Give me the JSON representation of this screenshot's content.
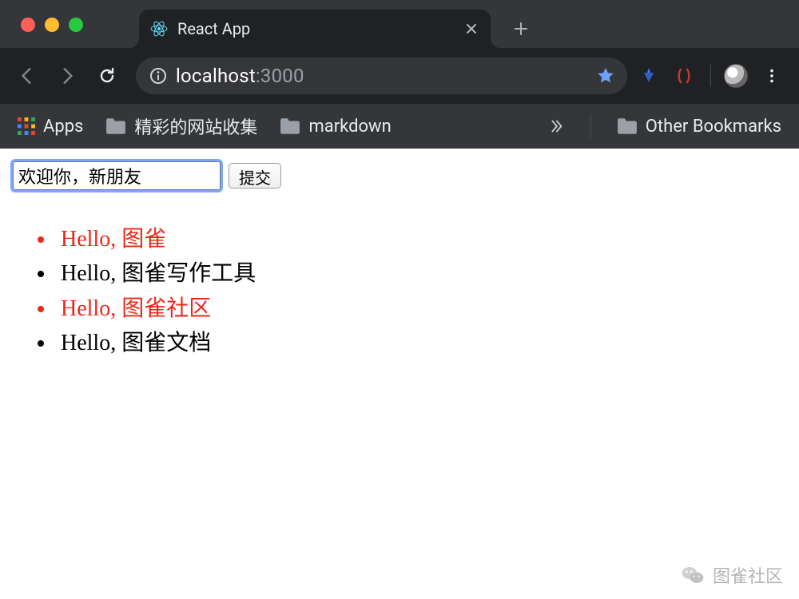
{
  "browser": {
    "tab_title": "React App",
    "url_host": "localhost",
    "url_port": ":3000",
    "bookmarks": {
      "apps": "Apps",
      "site_collection": "精彩的网站收集",
      "markdown": "markdown",
      "other": "Other Bookmarks"
    }
  },
  "page": {
    "input_value": "欢迎你，新朋友",
    "submit_label": "提交",
    "items": [
      {
        "text": "Hello, 图雀",
        "red": true
      },
      {
        "text": "Hello, 图雀写作工具",
        "red": false
      },
      {
        "text": "Hello, 图雀社区",
        "red": true
      },
      {
        "text": "Hello, 图雀文档",
        "red": false
      }
    ]
  },
  "watermark": {
    "label": "图雀社区"
  }
}
